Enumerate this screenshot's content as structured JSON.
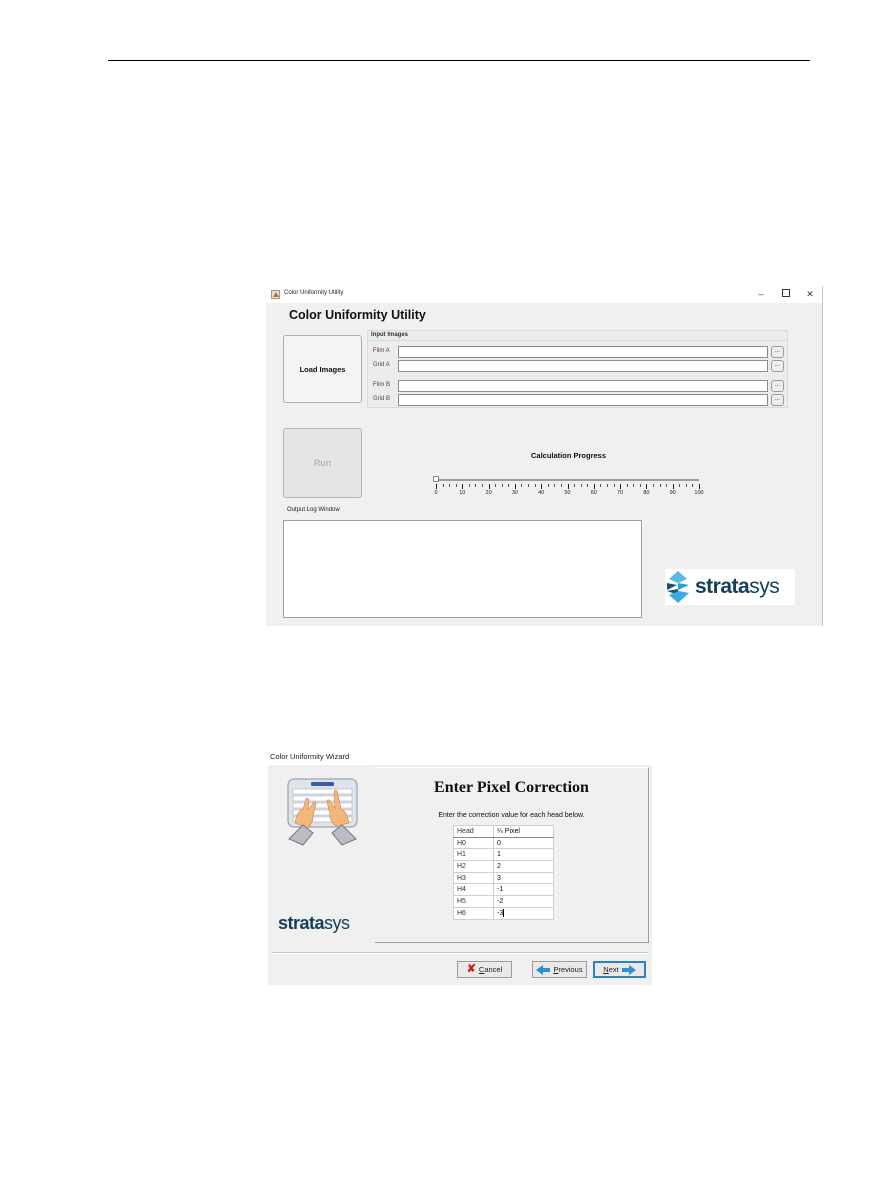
{
  "utility_window": {
    "titlebar_title": "Color Uniformity Utility",
    "controls": {
      "minimize": "–",
      "close": "✕"
    },
    "heading": "Color Uniformity Utility",
    "load_images_label": "Load Images",
    "input_group": {
      "title": "Input Images",
      "fields": [
        {
          "label_initial": "F",
          "label_rest": "ilm A",
          "value": "",
          "browse_label": "..."
        },
        {
          "label_initial": "",
          "label_rest": "Grid A",
          "value": "",
          "browse_label": "..."
        },
        {
          "label_initial": "F",
          "label_rest": "ilm B",
          "value": "",
          "browse_label": "..."
        },
        {
          "label_initial": "",
          "label_rest": "Grid B",
          "value": "",
          "browse_label": "..."
        }
      ]
    },
    "run_label": "Run",
    "progress": {
      "title": "Calculation Progress",
      "value": 0,
      "min": 0,
      "max": 100,
      "tick_labels": [
        "0",
        "10",
        "20",
        "30",
        "40",
        "50",
        "60",
        "70",
        "80",
        "90",
        "100"
      ]
    },
    "output_log": {
      "label": "Output Log Window",
      "content": ""
    },
    "logo": {
      "bold": "strata",
      "light": "sys"
    }
  },
  "wizard": {
    "caption": "Color Uniformity Wizard",
    "title": "Enter Pixel Correction",
    "instruction": "Enter the correction value for each head below.",
    "table": {
      "headers": [
        "Head",
        "¼ Pixel"
      ],
      "rows": [
        {
          "head": "H0",
          "value": "0"
        },
        {
          "head": "H1",
          "value": "1"
        },
        {
          "head": "H2",
          "value": "2"
        },
        {
          "head": "H3",
          "value": "3"
        },
        {
          "head": "H4",
          "value": "-1"
        },
        {
          "head": "H5",
          "value": "-2"
        },
        {
          "head": "H6",
          "value": "-3"
        }
      ]
    },
    "logo": {
      "bold": "strata",
      "light": "sys"
    },
    "buttons": {
      "cancel": {
        "mnemonic": "C",
        "rest": "ancel"
      },
      "previous": {
        "mnemonic": "P",
        "rest": "revious"
      },
      "next": {
        "mnemonic": "N",
        "rest": "ext"
      }
    }
  }
}
